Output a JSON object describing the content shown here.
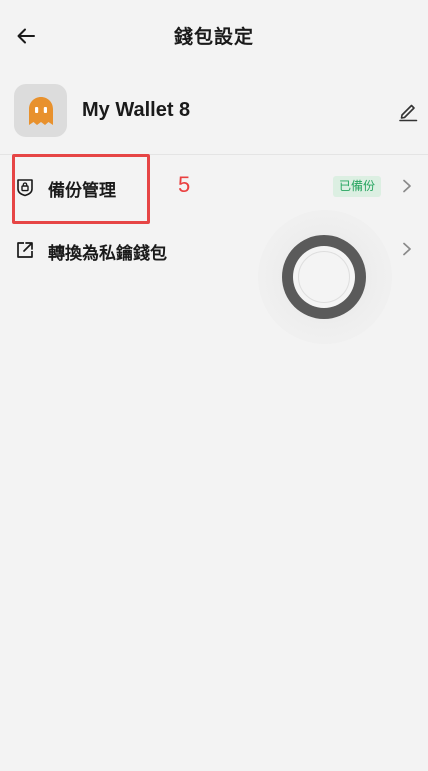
{
  "header": {
    "title": "錢包設定",
    "back_icon": "arrow-left-icon"
  },
  "wallet": {
    "name": "My Wallet 8",
    "avatar_icon": "orange-ghost-avatar",
    "avatar_color": "#e8912d",
    "edit_icon": "pencil-icon"
  },
  "menu": [
    {
      "label": "備份管理",
      "icon": "shield-lock-icon",
      "badge": "已備份",
      "badge_text_color": "#27a560",
      "badge_bg_color": "#dcefe2"
    },
    {
      "label": "轉換為私鑰錢包",
      "icon": "external-link-icon"
    }
  ],
  "annotation": {
    "number": "5",
    "color": "#e64545"
  },
  "floating_button": {
    "icon": "assistive-touch-icon"
  }
}
